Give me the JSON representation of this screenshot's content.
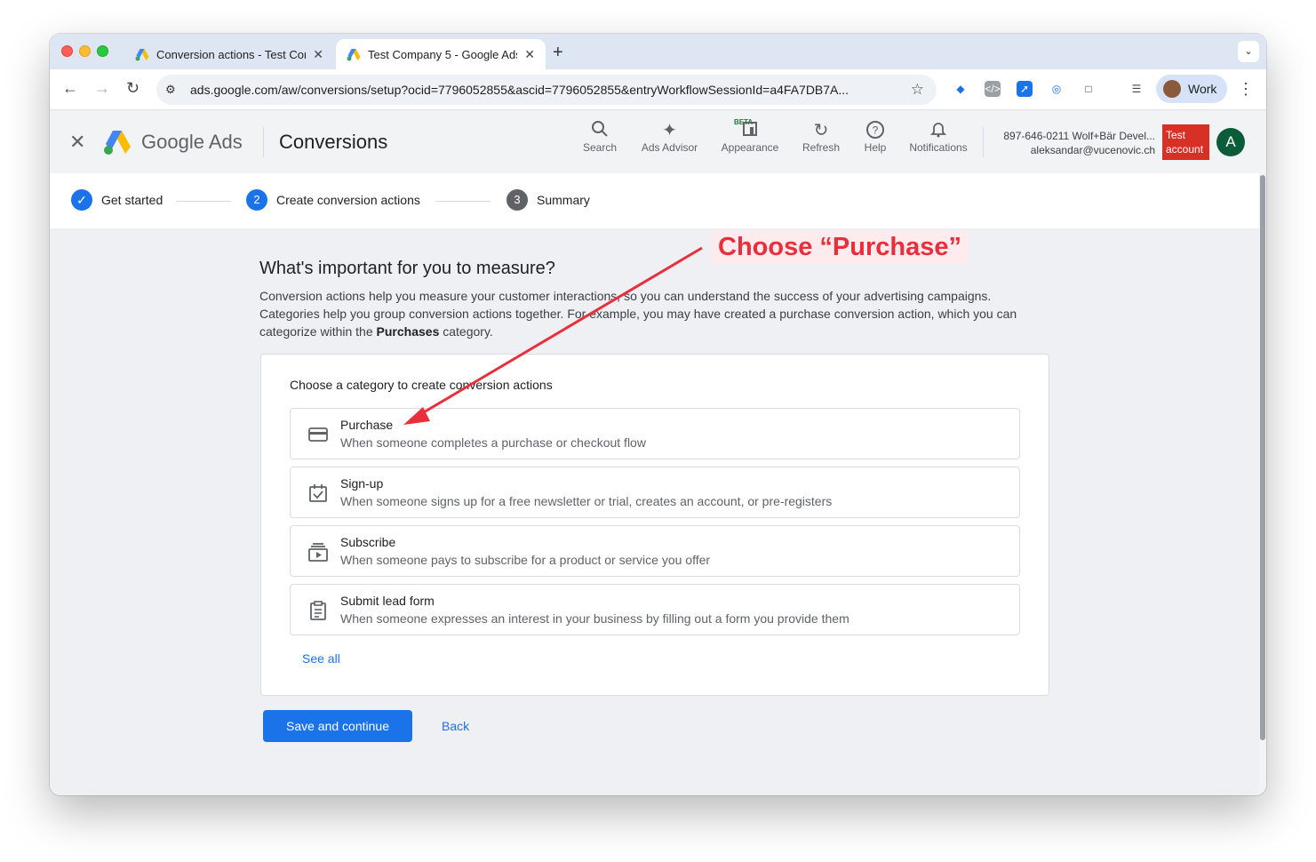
{
  "browser": {
    "tabs": [
      {
        "title": "Conversion actions - Test Cor",
        "close": "✕"
      },
      {
        "title": "Test Company 5 - Google Ads",
        "close": "✕"
      }
    ],
    "new_tab": "+",
    "url": "ads.google.com/aw/conversions/setup?ocid=7796052855&ascid=7796052855&entryWorkflowSessionId=a4FA7DB7A...",
    "profile_label": "Work"
  },
  "header": {
    "brand": "Google Ads",
    "section": "Conversions",
    "buttons": [
      {
        "label": "Search",
        "icon": "search-icon"
      },
      {
        "label": "Ads Advisor",
        "icon": "sparkle-icon"
      },
      {
        "label": "Appearance",
        "icon": "appearance-icon"
      },
      {
        "label": "Refresh",
        "icon": "refresh-icon"
      },
      {
        "label": "Help",
        "icon": "help-icon"
      },
      {
        "label": "Notifications",
        "icon": "bell-icon"
      }
    ],
    "beta": "BETA",
    "account_line": "897-646-0211 Wolf+Bär Devel...",
    "email": "aleksandar@vucenovic.ch",
    "test_badge": "Test account",
    "avatar_letter": "A"
  },
  "stepper": {
    "steps": [
      {
        "label": "Get started",
        "num": "✓",
        "state": "done"
      },
      {
        "label": "Create conversion actions",
        "num": "2",
        "state": "active"
      },
      {
        "label": "Summary",
        "num": "3",
        "state": "upcoming"
      }
    ]
  },
  "main": {
    "heading": "What's important for you to measure?",
    "desc_1": "Conversion actions help you measure your customer interactions, so you can understand the success of your advertising campaigns.",
    "desc_2": "Categories help you group conversion actions together. For example, you may have created a purchase conversion action, which you can categorize within the ",
    "desc_bold": "Purchases",
    "desc_3": " category.",
    "card_title": "Choose a category to create conversion actions",
    "options": [
      {
        "name": "Purchase",
        "desc": "When someone completes a purchase or checkout flow",
        "icon": "credit-card-icon"
      },
      {
        "name": "Sign-up",
        "desc": "When someone signs up for a free newsletter or trial, creates an account, or pre-registers",
        "icon": "checkbox-calendar-icon"
      },
      {
        "name": "Subscribe",
        "desc": "When someone pays to subscribe for a product or service you offer",
        "icon": "subscriptions-icon"
      },
      {
        "name": "Submit lead form",
        "desc": "When someone expresses an interest in your business by filling out a form you provide them",
        "icon": "clipboard-form-icon"
      }
    ],
    "see_all": "See all",
    "save_button": "Save and continue",
    "back_button": "Back"
  },
  "annotation": {
    "label": "Choose “Purchase”",
    "color": "#ea2f3c"
  },
  "colors": {
    "accent": "#1a73e8",
    "test_badge": "#d93025"
  }
}
